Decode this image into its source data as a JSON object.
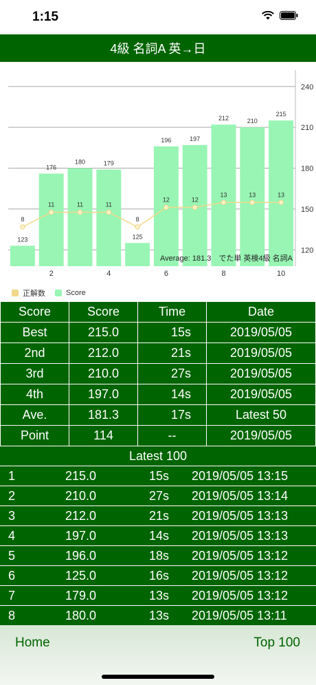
{
  "status": {
    "time": "1:15"
  },
  "nav": {
    "title": "4級 名詞A 英→日"
  },
  "chart_data": {
    "type": "bar",
    "categories": [
      "1",
      "2",
      "3",
      "4",
      "5",
      "6",
      "7",
      "8",
      "9",
      "10"
    ],
    "x_tick_labels": [
      "2",
      "4",
      "6",
      "8",
      "10"
    ],
    "series": [
      {
        "name": "Score",
        "values": [
          123,
          176,
          180,
          179,
          125,
          196,
          197,
          212,
          210,
          215
        ],
        "color": "#98f5b4"
      },
      {
        "name": "正解数",
        "values": [
          8,
          11,
          11,
          11,
          8,
          12,
          12,
          13,
          13,
          13
        ],
        "color": "#f0d98a"
      }
    ],
    "y_ticks": [
      120,
      150,
      180,
      210,
      240
    ],
    "ylim": [
      108,
      252
    ],
    "annotation": "Average: 181.3　でた単 英検4級 名詞A",
    "legend_position": "bottom-left"
  },
  "legend": {
    "correct_label": "正解数",
    "score_label": "Score"
  },
  "best_table": {
    "headers": [
      "Score",
      "Score",
      "Time",
      "Date"
    ],
    "rows": [
      [
        "Best",
        "215.0",
        "15s",
        "2019/05/05"
      ],
      [
        "2nd",
        "212.0",
        "21s",
        "2019/05/05"
      ],
      [
        "3rd",
        "210.0",
        "27s",
        "2019/05/05"
      ],
      [
        "4th",
        "197.0",
        "14s",
        "2019/05/05"
      ],
      [
        "Ave.",
        "181.3",
        "17s",
        "Latest 50"
      ],
      [
        "Point",
        "114",
        "--",
        "2019/05/05"
      ]
    ]
  },
  "latest": {
    "title": "Latest 100",
    "rows": [
      [
        "1",
        "215.0",
        "15s",
        "2019/05/05 13:15"
      ],
      [
        "2",
        "210.0",
        "27s",
        "2019/05/05 13:14"
      ],
      [
        "3",
        "212.0",
        "21s",
        "2019/05/05 13:13"
      ],
      [
        "4",
        "197.0",
        "14s",
        "2019/05/05 13:13"
      ],
      [
        "5",
        "196.0",
        "18s",
        "2019/05/05 13:12"
      ],
      [
        "6",
        "125.0",
        "16s",
        "2019/05/05 13:12"
      ],
      [
        "7",
        "179.0",
        "13s",
        "2019/05/05 13:12"
      ],
      [
        "8",
        "180.0",
        "13s",
        "2019/05/05 13:11"
      ]
    ]
  },
  "bottom": {
    "home": "Home",
    "top100": "Top 100"
  }
}
